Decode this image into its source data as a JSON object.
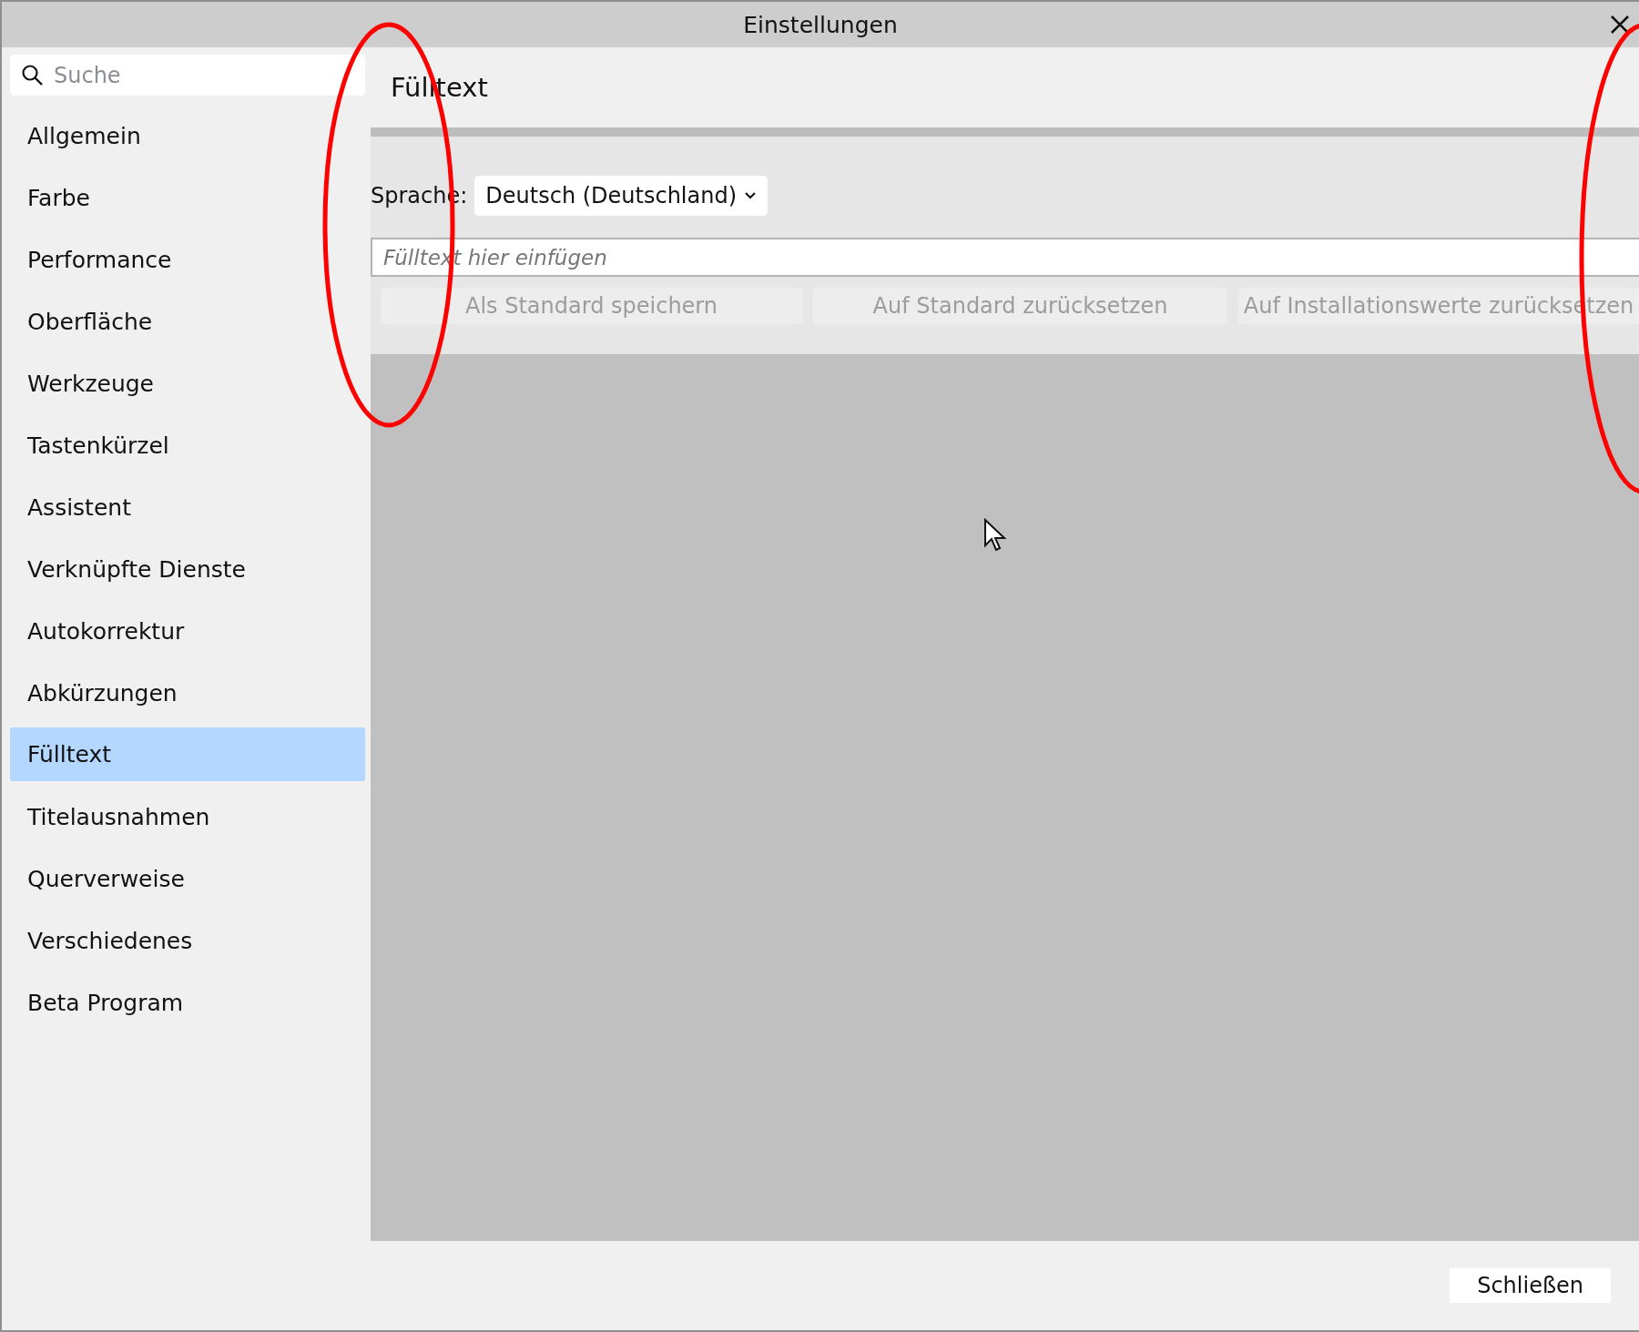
{
  "window": {
    "title": "Einstellungen"
  },
  "search": {
    "placeholder": "Suche"
  },
  "sidebar": {
    "items": [
      {
        "label": "Allgemein",
        "selected": false
      },
      {
        "label": "Farbe",
        "selected": false
      },
      {
        "label": "Performance",
        "selected": false
      },
      {
        "label": "Oberfläche",
        "selected": false
      },
      {
        "label": "Werkzeuge",
        "selected": false
      },
      {
        "label": "Tastenkürzel",
        "selected": false
      },
      {
        "label": "Assistent",
        "selected": false
      },
      {
        "label": "Verknüpfte Dienste",
        "selected": false
      },
      {
        "label": "Autokorrektur",
        "selected": false
      },
      {
        "label": "Abkürzungen",
        "selected": false
      },
      {
        "label": "Fülltext",
        "selected": true
      },
      {
        "label": "Titelausnahmen",
        "selected": false
      },
      {
        "label": "Querverweise",
        "selected": false
      },
      {
        "label": "Verschiedenes",
        "selected": false
      },
      {
        "label": "Beta Program",
        "selected": false
      }
    ]
  },
  "content": {
    "title": "Fülltext",
    "language": {
      "label": "Sprache:",
      "value": "Deutsch (Deutschland)"
    },
    "text_field": {
      "placeholder": "Fülltext hier einfügen"
    },
    "buttons": [
      {
        "label": "Als Standard speichern",
        "disabled": true
      },
      {
        "label": "Auf Standard zurücksetzen",
        "disabled": true
      },
      {
        "label": "Auf Installationswerte zurücksetzen",
        "disabled": true
      }
    ]
  },
  "footer": {
    "buttons": [
      "Schließen"
    ]
  }
}
